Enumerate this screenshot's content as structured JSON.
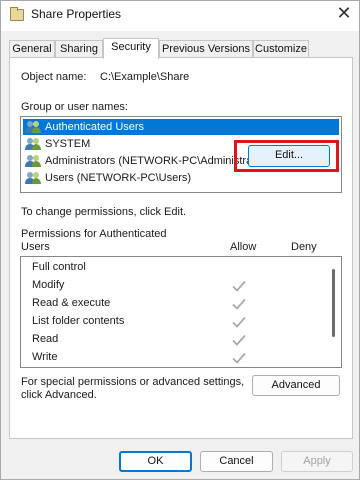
{
  "window": {
    "title": "Share Properties",
    "close_glyph": "✕"
  },
  "tabs": [
    {
      "label": "General"
    },
    {
      "label": "Sharing"
    },
    {
      "label": "Security"
    },
    {
      "label": "Previous Versions"
    },
    {
      "label": "Customize"
    }
  ],
  "security": {
    "object_name_label": "Object name:",
    "object_name_value": "C:\\Example\\Share",
    "group_label": "Group or user names:",
    "users": [
      {
        "name": "Authenticated Users",
        "selected": true
      },
      {
        "name": "SYSTEM",
        "selected": false
      },
      {
        "name": "Administrators (NETWORK-PC\\Administrators)",
        "selected": false
      },
      {
        "name": "Users (NETWORK-PC\\Users)",
        "selected": false
      }
    ],
    "change_text": "To change permissions, click Edit.",
    "edit_label": "Edit...",
    "permissions_for_line1": "Permissions for Authenticated",
    "permissions_for_line2": "Users",
    "allow_header": "Allow",
    "deny_header": "Deny",
    "permissions": [
      {
        "name": "Full control",
        "allow": false
      },
      {
        "name": "Modify",
        "allow": true
      },
      {
        "name": "Read & execute",
        "allow": true
      },
      {
        "name": "List folder contents",
        "allow": true
      },
      {
        "name": "Read",
        "allow": true
      },
      {
        "name": "Write",
        "allow": true
      }
    ],
    "special_line1": "For special permissions or advanced settings,",
    "special_line2": "click Advanced.",
    "advanced_label": "Advanced"
  },
  "footer": {
    "ok_label": "OK",
    "cancel_label": "Cancel",
    "apply_label": "Apply"
  },
  "colors": {
    "selection": "#0078d7",
    "highlight": "#e0141e"
  }
}
